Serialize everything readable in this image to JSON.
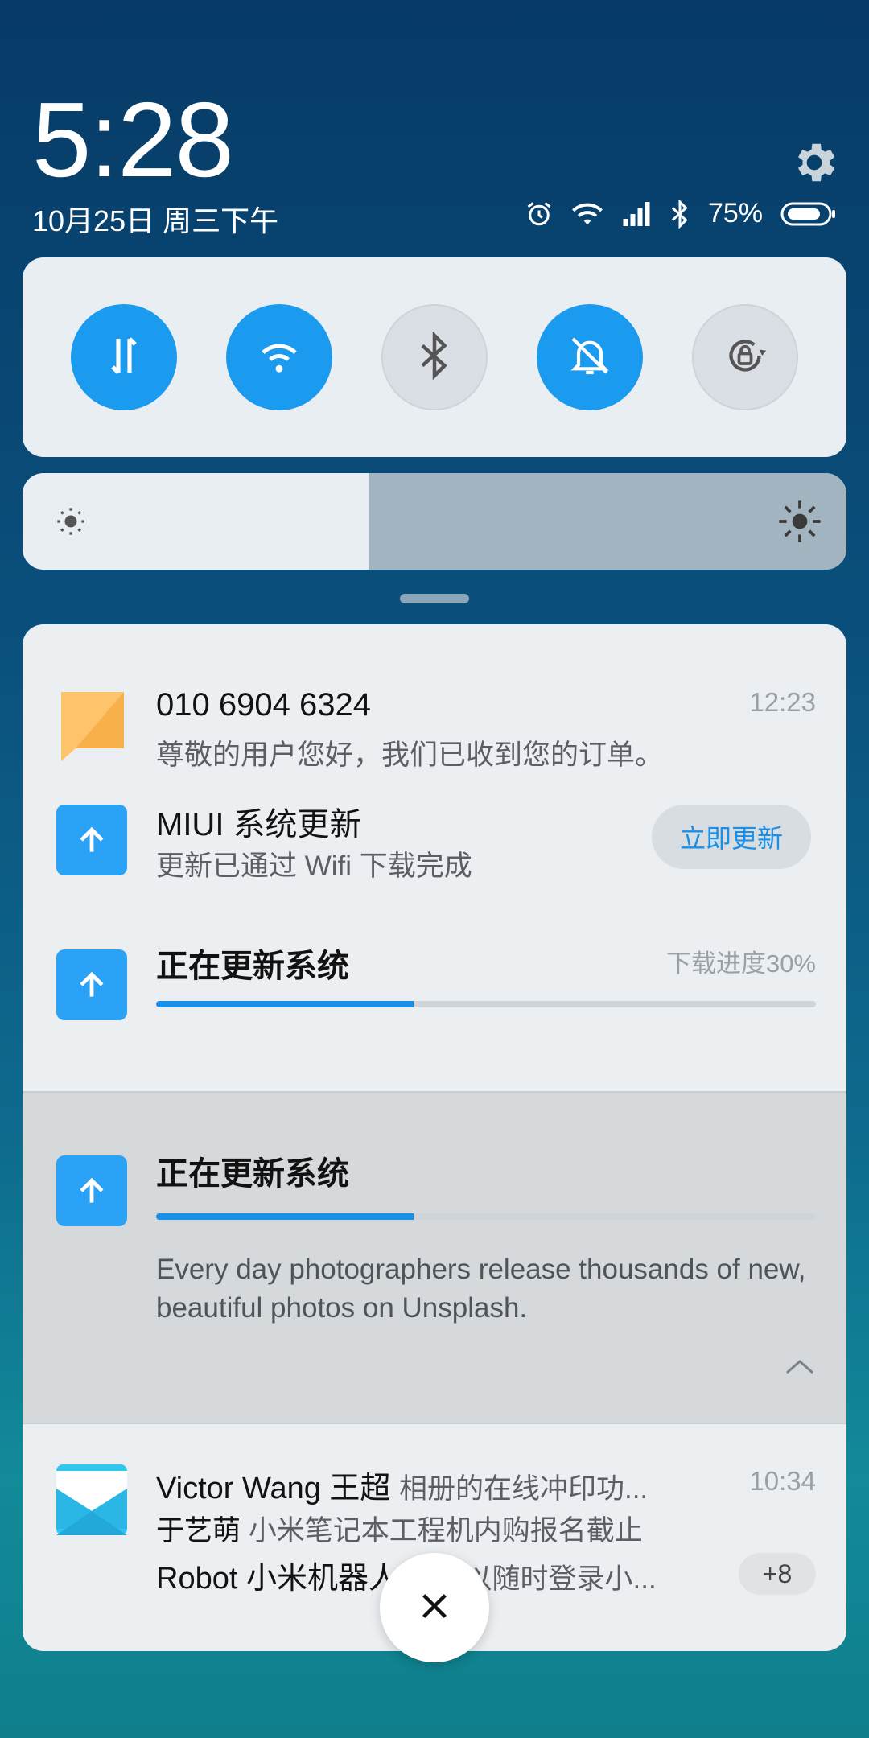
{
  "header": {
    "time": "5:28",
    "date": "10月25日 周三下午",
    "battery": "75%"
  },
  "notifications": {
    "sms": {
      "title": "010  6904  6324",
      "message": "尊敬的用户您好，我们已收到您的订单。",
      "time": "12:23"
    },
    "miui_update": {
      "title": "MIUI  系统更新",
      "subtitle": "更新已通过 Wifi 下载完成",
      "button": "立即更新"
    },
    "updating": {
      "title": "正在更新系统",
      "progress_label": "下载进度30%",
      "progress": 0.39
    },
    "updating_expanded": {
      "title": "正在更新系统",
      "progress": 0.39,
      "description": "Every day photographers release thousands of new, beautiful photos on Unsplash."
    },
    "mail": {
      "time": "10:34",
      "count": "+8",
      "lines": [
        {
          "sender": "Victor  Wang  王超",
          "preview": "相册的在线冲印功..."
        },
        {
          "sender": "于艺萌",
          "preview": "小米笔记本工程机内购报名截止"
        },
        {
          "sender": "Robot  小米机器人",
          "preview": "您可以随时登录小..."
        }
      ]
    }
  },
  "brightness": 0.42,
  "colors": {
    "accent": "#1a9bf0",
    "panel": "#eceff2"
  }
}
